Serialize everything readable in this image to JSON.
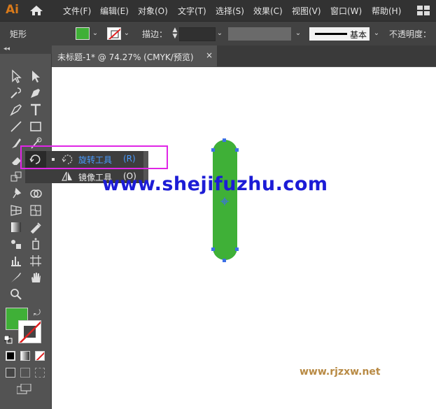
{
  "app": {
    "logo": "Ai"
  },
  "menu": [
    "文件(F)",
    "编辑(E)",
    "对象(O)",
    "文字(T)",
    "选择(S)",
    "效果(C)",
    "视图(V)",
    "窗口(W)",
    "帮助(H)"
  ],
  "control_bar": {
    "object_type": "矩形",
    "stroke_label": "描边：",
    "brush_label": "基本",
    "opacity_label": "不透明度："
  },
  "document_tab": {
    "title": "未标题-1* @ 74.27% (CMYK/预览)",
    "close": "×"
  },
  "flyout": {
    "items": [
      {
        "label": "旋转工具",
        "shortcut": "(R)"
      },
      {
        "label": "镜像工具",
        "shortcut": "(O)"
      }
    ]
  },
  "watermarks": {
    "primary": "www.shejifuzhu.com",
    "secondary": "www.rjzxw.net"
  },
  "colors": {
    "fill": "#3fb037",
    "highlight": "#e026e6",
    "accent_text": "#4a9cff",
    "anchor": "#3c6fe6"
  }
}
